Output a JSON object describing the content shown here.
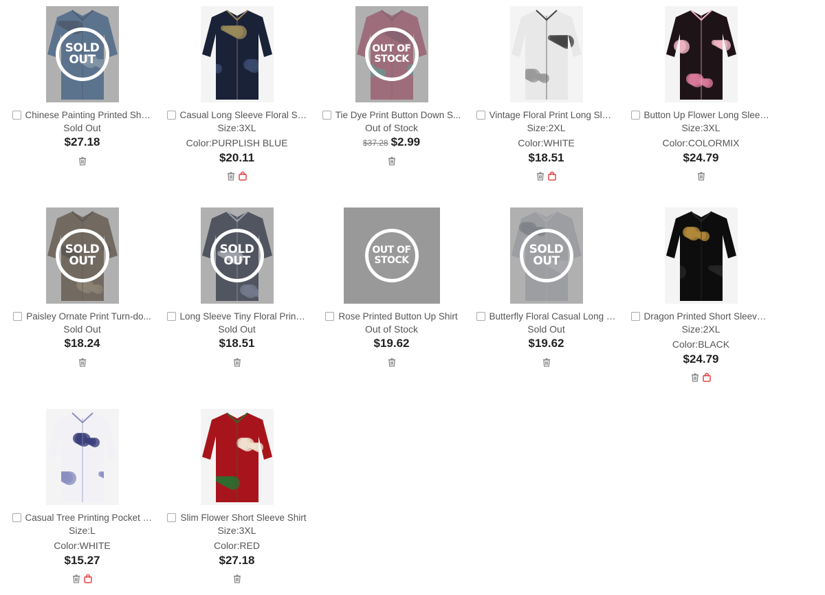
{
  "labels": {
    "sold_out": "SOLD\nOUT",
    "out_of_stock": "OUT OF\nSTOCK"
  },
  "products": [
    {
      "name": "Chinese Painting Printed Sho...",
      "status": "Sold Out",
      "price": "$27.18",
      "stamp": "sold",
      "cart": false,
      "palette": [
        "#3a6ea8",
        "#8fb7dd",
        "#1f3b64"
      ]
    },
    {
      "name": "Casual Long Sleeve Floral Shirt",
      "size": "Size:3XL",
      "color": "Color:PURPLISH BLUE",
      "price": "$20.11",
      "cart": true,
      "palette": [
        "#1a2238",
        "#3c4a6e",
        "#9a8a5a"
      ]
    },
    {
      "name": "Tie Dye Print Button Down S...",
      "status": "Out of Stock",
      "old_price": "$37.28",
      "price": "$2.99",
      "stamp": "oos",
      "cart": false,
      "palette": [
        "#c9617e",
        "#5fb3b0",
        "#9b4a6a"
      ]
    },
    {
      "name": "Vintage Floral Print Long Slee...",
      "size": "Size:2XL",
      "color": "Color:WHITE",
      "price": "$18.51",
      "cart": true,
      "palette": [
        "#e8e8e8",
        "#999999",
        "#444444"
      ]
    },
    {
      "name": "Button Up Flower Long Sleev...",
      "size": "Size:3XL",
      "color": "Color:COLORMIX",
      "price": "$24.79",
      "cart": false,
      "palette": [
        "#1e1418",
        "#d97a9a",
        "#f2b8c8"
      ]
    },
    {
      "name": "Paisley Ornate Print Turn-do...",
      "status": "Sold Out",
      "price": "$18.24",
      "stamp": "sold",
      "cart": false,
      "palette": [
        "#6b5a44",
        "#a38f70",
        "#3b3228"
      ]
    },
    {
      "name": "Long Sleeve Tiny Floral Printe...",
      "status": "Sold Out",
      "price": "$18.51",
      "stamp": "sold",
      "cart": false,
      "palette": [
        "#202a44",
        "#6d7aa0",
        "#c9cfe0"
      ]
    },
    {
      "name": "Rose Printed Button Up Shirt",
      "status": "Out of Stock",
      "price": "$19.62",
      "stamp": "oos",
      "cart": false,
      "blank": true,
      "palette": [
        "#999999",
        "#999999",
        "#999999"
      ]
    },
    {
      "name": "Butterfly Floral Casual Long S...",
      "status": "Sold Out",
      "price": "$19.62",
      "stamp": "sold",
      "cart": false,
      "palette": [
        "#c8ccd4",
        "#8b909a",
        "#e2e4ea"
      ]
    },
    {
      "name": "Dragon Printed Short Sleeve ...",
      "size": "Size:2XL",
      "color": "Color:BLACK",
      "price": "$24.79",
      "cart": true,
      "palette": [
        "#0d0d0d",
        "#b38a3a",
        "#262626"
      ]
    },
    {
      "name": "Casual Tree Printing Pocket D...",
      "size": "Size:L",
      "color": "Color:WHITE",
      "price": "$15.27",
      "cart": true,
      "palette": [
        "#f2f2f6",
        "#3a3f7a",
        "#8a8fc0"
      ]
    },
    {
      "name": "Slim Flower Short Sleeve Shirt",
      "size": "Size:3XL",
      "color": "Color:RED",
      "price": "$27.18",
      "cart": false,
      "palette": [
        "#a8141c",
        "#f0e2d0",
        "#2e6b2e"
      ]
    }
  ]
}
